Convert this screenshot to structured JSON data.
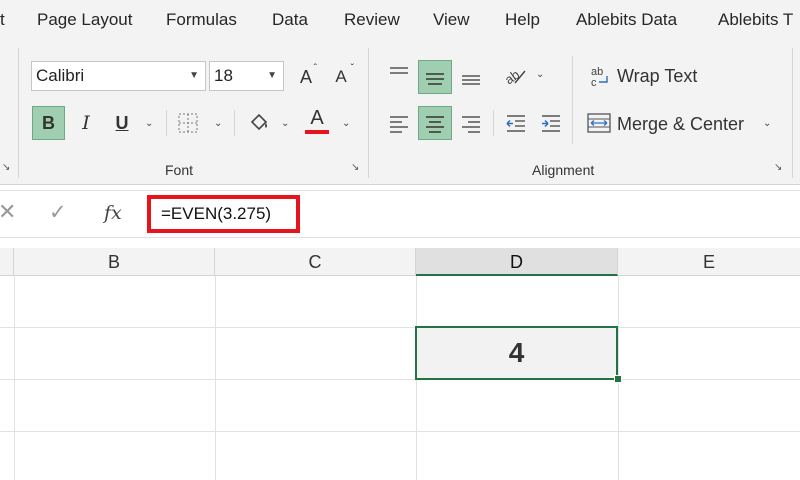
{
  "menu": {
    "items": [
      "t",
      "Page Layout",
      "Formulas",
      "Data",
      "Review",
      "View",
      "Help",
      "Ablebits Data",
      "Ablebits T"
    ]
  },
  "ribbon": {
    "font_group": {
      "font_name": "Calibri",
      "font_size": "18",
      "bold_label": "B",
      "italic_label": "I",
      "underline_label": "U",
      "grow_label": "A",
      "shrink_label": "A",
      "font_color_label": "A",
      "font_color_hex": "#e8141b",
      "label": "Font"
    },
    "alignment_group": {
      "wrap_text_label": "Wrap Text",
      "merge_center_label": "Merge & Center",
      "label": "Alignment"
    },
    "active_button_color": "#9fcfb0"
  },
  "formula_bar": {
    "cancel_icon": "close-icon",
    "enter_icon": "check-icon",
    "fx_label": "fx",
    "formula": "=EVEN(3.275)",
    "highlight_color": "#e8141b"
  },
  "grid": {
    "columns": [
      "B",
      "C",
      "D",
      "E"
    ],
    "selected_column": "D",
    "active_cell_value": "4",
    "selection_color": "#217346"
  }
}
